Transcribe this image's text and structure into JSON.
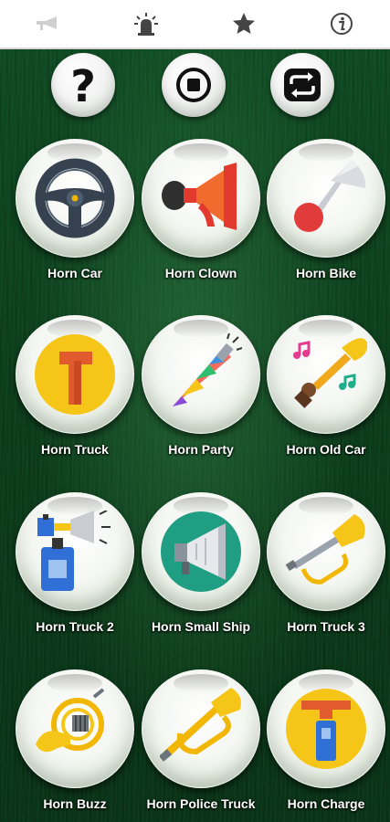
{
  "tabs": [
    {
      "icon": "horn-tab-icon"
    },
    {
      "icon": "siren-tab-icon"
    },
    {
      "icon": "star-tab-icon"
    },
    {
      "icon": "info-tab-icon"
    }
  ],
  "controls": [
    {
      "icon": "question-icon",
      "glyph": "?"
    },
    {
      "icon": "stop-icon"
    },
    {
      "icon": "repeat-icon"
    }
  ],
  "horns": [
    {
      "label": "Horn Car",
      "icon": "steering-wheel-icon"
    },
    {
      "label": "Horn Clown",
      "icon": "clown-horn-icon"
    },
    {
      "label": "Horn Bike",
      "icon": "bike-horn-icon"
    },
    {
      "label": "Horn Truck",
      "icon": "truck-horn-icon"
    },
    {
      "label": "Horn Party",
      "icon": "party-horn-icon"
    },
    {
      "label": "Horn Old Car",
      "icon": "trumpet-music-icon"
    },
    {
      "label": "Horn Truck 2",
      "icon": "air-horn-icon"
    },
    {
      "label": "Horn Small Ship",
      "icon": "megaphone-icon"
    },
    {
      "label": "Horn Truck 3",
      "icon": "bugle-icon"
    },
    {
      "label": "Horn Buzz",
      "icon": "french-horn-icon"
    },
    {
      "label": "Horn Police Truck",
      "icon": "police-bugle-icon"
    },
    {
      "label": "Horn Charge",
      "icon": "charge-horn-icon"
    }
  ],
  "colors": {
    "background": "#0d3d1c",
    "tabbar": "#ffffff",
    "label_text": "#ffffff",
    "icon_dark": "#333333"
  }
}
